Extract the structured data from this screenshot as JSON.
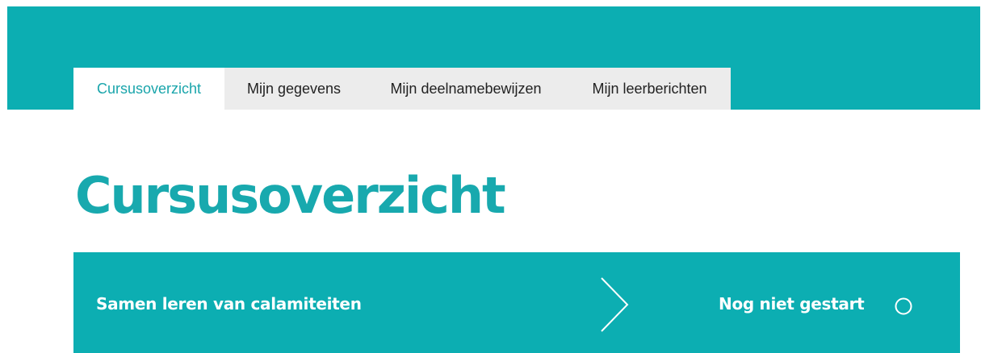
{
  "colors": {
    "brand": "#0caeb2",
    "title": "#18a9ae",
    "tab_active_text": "#1aa5ab",
    "tab_bg": "#ececec",
    "tab_text": "#222222"
  },
  "nav": {
    "tabs": [
      {
        "label": "Cursusoverzicht",
        "active": true
      },
      {
        "label": "Mijn gegevens",
        "active": false
      },
      {
        "label": "Mijn deelnamebewijzen",
        "active": false
      },
      {
        "label": "Mijn leerberichten",
        "active": false
      }
    ]
  },
  "main": {
    "title": "Cursusoverzicht",
    "courses": [
      {
        "name": "Samen leren van calamiteiten",
        "status": "Nog niet gestart",
        "arrow_icon": "chevron-right-icon",
        "status_icon": "empty-circle-icon"
      }
    ]
  }
}
